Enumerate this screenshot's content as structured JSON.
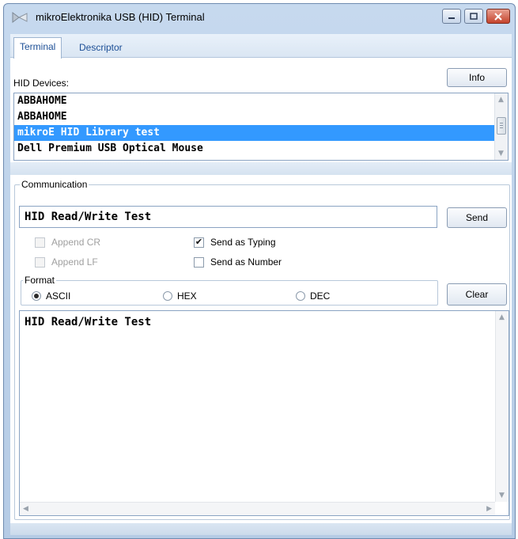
{
  "window": {
    "title": "mikroElektronika USB (HID) Terminal"
  },
  "tabs": [
    {
      "label": "Terminal",
      "active": true
    },
    {
      "label": "Descriptor",
      "active": false
    }
  ],
  "devices": {
    "label": "HID Devices:",
    "info_button": "Info",
    "items": [
      {
        "label": "ABBAHOME",
        "selected": false
      },
      {
        "label": "ABBAHOME",
        "selected": false
      },
      {
        "label": "mikroE HID Library test",
        "selected": true
      },
      {
        "label": "Dell Premium USB Optical Mouse",
        "selected": false
      }
    ]
  },
  "communication": {
    "legend": "Communication",
    "input_value": "HID Read/Write Test",
    "send_button": "Send",
    "append_cr": {
      "label": "Append CR",
      "checked": false,
      "enabled": false
    },
    "append_lf": {
      "label": "Append LF",
      "checked": false,
      "enabled": false
    },
    "send_as_typing": {
      "label": "Send as Typing",
      "checked": true
    },
    "send_as_number": {
      "label": "Send as Number",
      "checked": false
    },
    "format": {
      "legend": "Format",
      "options": [
        {
          "label": "ASCII",
          "selected": true
        },
        {
          "label": "HEX",
          "selected": false
        },
        {
          "label": "DEC",
          "selected": false
        }
      ]
    },
    "clear_button": "Clear",
    "output_text": "HID Read/Write Test"
  },
  "colors": {
    "selection": "#3399ff",
    "close_button": "#c5432c"
  }
}
